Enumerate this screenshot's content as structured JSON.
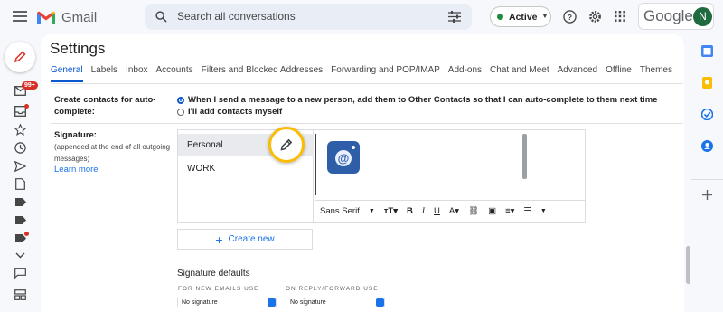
{
  "header": {
    "app_name": "Gmail",
    "search_placeholder": "Search all conversations",
    "status_label": "Active",
    "google_word": "Google",
    "avatar_initial": "N"
  },
  "rail": {
    "inbox_badge": "99+"
  },
  "settings": {
    "title": "Settings",
    "tabs": [
      "General",
      "Labels",
      "Inbox",
      "Accounts",
      "Filters and Blocked Addresses",
      "Forwarding and POP/IMAP",
      "Add-ons",
      "Chat and Meet",
      "Advanced",
      "Offline",
      "Themes"
    ],
    "active_tab": "General",
    "contacts": {
      "label_line1": "Create contacts for auto-",
      "label_line2": "complete:",
      "option1": "When I send a message to a new person, add them to Other Contacts so that I can auto-complete to them next time",
      "option2": "I'll add contacts myself",
      "selected": "option1"
    },
    "signature": {
      "label": "Signature:",
      "note_line1": "(appended at the end of all outgoing",
      "note_line2": "messages)",
      "learn_more": "Learn more",
      "items": [
        "Personal",
        "WORK"
      ],
      "selected_item": "Personal",
      "font_name": "Sans Serif",
      "create_new": "Create new"
    },
    "signature_defaults": {
      "title": "Signature defaults",
      "new_emails_label": "FOR NEW EMAILS USE",
      "new_emails_value": "No signature",
      "reply_label": "ON REPLY/FORWARD USE",
      "reply_value": "No signature"
    }
  },
  "colors": {
    "accent": "#0b57d0",
    "link": "#1a73e8",
    "badge": "#d93025",
    "highlight_ring": "#fbbc04",
    "status_green": "#1e8e3e"
  }
}
